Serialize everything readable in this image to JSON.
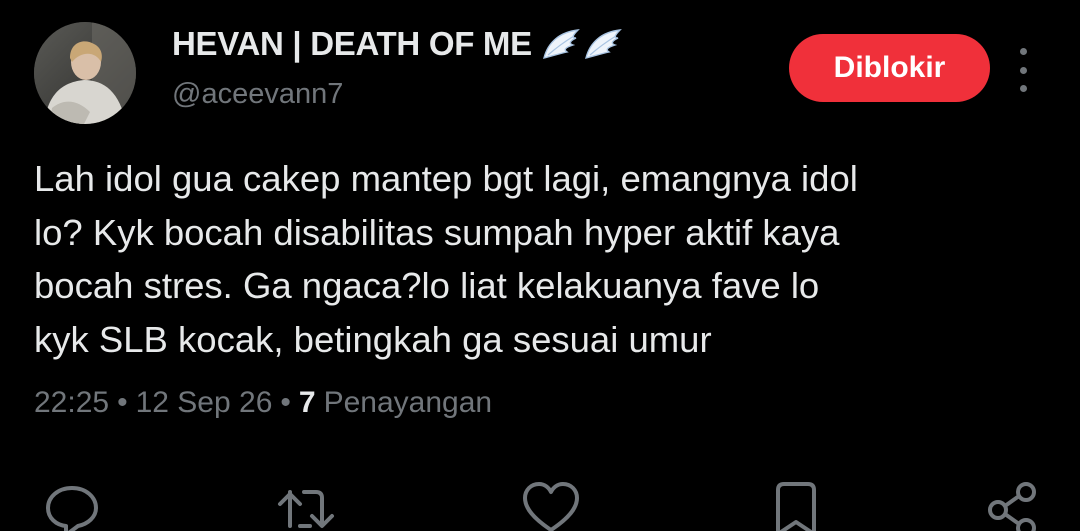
{
  "user": {
    "display_name": "HEVAN | DEATH OF ME",
    "wings_icon": "wing-emoji",
    "handle": "@aceevann7"
  },
  "header_actions": {
    "blocked_label": "Diblokir",
    "more_icon": "more-vertical-icon"
  },
  "tweet": {
    "text": "Lah idol gua cakep mantep bgt lagi, emangnya idol\nlo? Kyk bocah disabilitas sumpah hyper aktif kaya\nbocah stres. Ga ngaca?lo liat kelakuanya fave lo\nkyk SLB kocak, betingkah ga sesuai umur",
    "time": "22:25",
    "date": "12 Sep 26",
    "separator": "•",
    "views_count": "7",
    "views_label": "Penayangan"
  },
  "actions": [
    {
      "icon": "reply-icon"
    },
    {
      "icon": "retweet-icon"
    },
    {
      "icon": "like-icon"
    },
    {
      "icon": "bookmark-icon"
    },
    {
      "icon": "share-icon"
    }
  ],
  "colors": {
    "background": "#000000",
    "primary_text": "#e7e9ea",
    "secondary_text": "#71767b",
    "blocked_button": "#f0303a"
  }
}
